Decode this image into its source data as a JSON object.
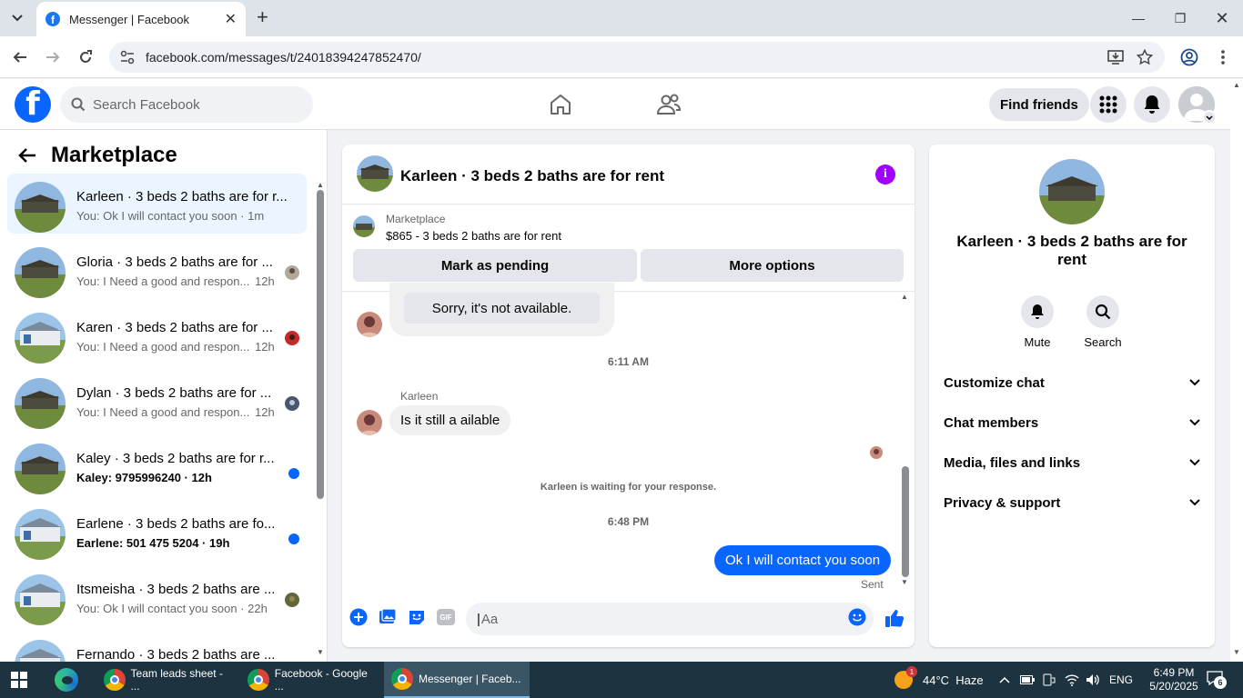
{
  "browser": {
    "tab_title": "Messenger | Facebook",
    "url": "facebook.com/messages/t/24018394247852470/"
  },
  "fb": {
    "search_placeholder": "Search Facebook",
    "find_friends": "Find friends"
  },
  "left": {
    "heading": "Marketplace",
    "conversations": [
      {
        "name": "Karleen · 3 beds 2 baths are for r...",
        "snippet": "You: Ok I will contact you soon · 1m",
        "unread": false,
        "active": true
      },
      {
        "name": "Gloria · 3 beds 2 baths are for ...",
        "snippet": "You: I Need a good and respon...",
        "time": "12h",
        "unread": false
      },
      {
        "name": "Karen · 3 beds 2 baths are for ...",
        "snippet": "You: I Need a good and respon...",
        "time": "12h",
        "unread": false
      },
      {
        "name": "Dylan · 3 beds 2 baths are for ...",
        "snippet": "You: I Need a good and respon...",
        "time": "12h",
        "unread": false
      },
      {
        "name": "Kaley · 3 beds 2 baths are for r...",
        "snippet": "Kaley: 9795996240 · 12h",
        "unread": true
      },
      {
        "name": "Earlene · 3 beds 2 baths are fo...",
        "snippet": "Earlene: 501 475 5204 · 19h",
        "unread": true
      },
      {
        "name": "Itsmeisha · 3 beds 2 baths are ...",
        "snippet": "You: Ok I will contact you soon · 22h",
        "unread": false
      },
      {
        "name": "Fernando · 3 beds 2 baths are ...",
        "snippet": "",
        "unread": false
      }
    ]
  },
  "chat": {
    "title": "Karleen · 3 beds 2 baths are for rent",
    "marketplace_label": "Marketplace",
    "listing": "$865 - 3 beds 2 baths are for rent",
    "mark_pending": "Mark as pending",
    "more_options": "More options",
    "msg_unavailable": "Sorry, it's not available.",
    "time1": "6:11 AM",
    "sender_name": "Karleen",
    "msg_question": "Is it still a ailable",
    "waiting": "Karleen is waiting for your response.",
    "time2": "6:48 PM",
    "msg_reply": "Ok I will contact you soon",
    "sent": "Sent",
    "composer_placeholder": "Aa",
    "gif": "GIF"
  },
  "right": {
    "name": "Karleen · 3 beds 2 baths are for rent",
    "mute": "Mute",
    "search": "Search",
    "rows": [
      "Customize chat",
      "Chat members",
      "Media, files and links",
      "Privacy & support"
    ]
  },
  "taskbar": {
    "items": [
      "Team leads sheet - ...",
      "Facebook - Google ...",
      "Messenger | Faceb..."
    ],
    "weather": "44°C  Haze",
    "lang": "ENG",
    "time": "6:49 PM",
    "date": "5/20/2025",
    "notif_count": "6",
    "weather_badge": "1"
  },
  "colors": {
    "fb_blue": "#0866ff",
    "info_purple": "#a100ff"
  }
}
